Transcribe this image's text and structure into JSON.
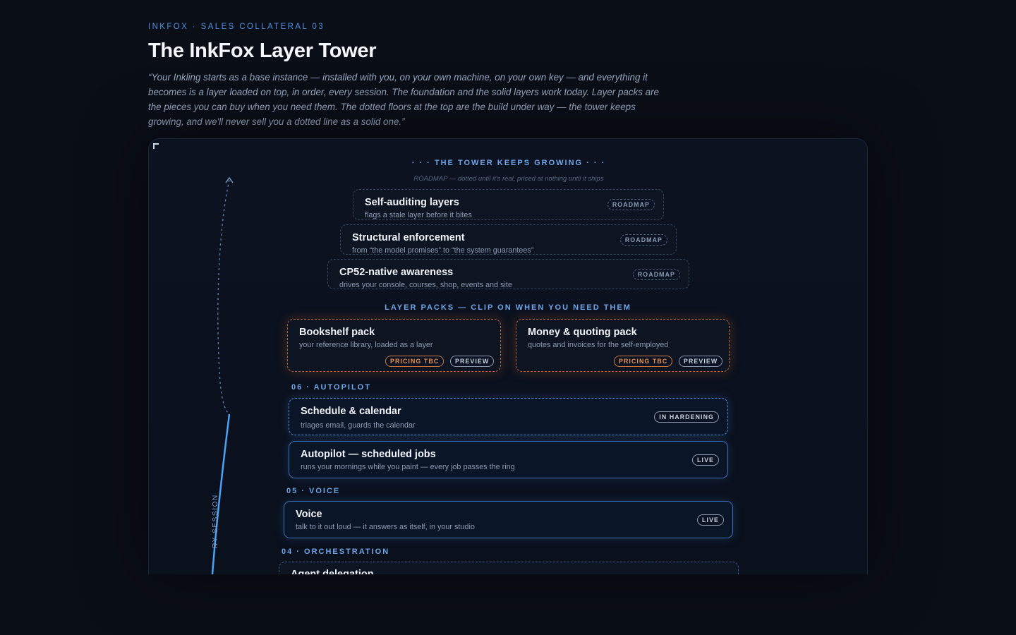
{
  "header": {
    "eyebrow": "INKFOX · SALES COLLATERAL 03",
    "title": "The InkFox Layer Tower",
    "intro": "“Your Inkling starts as a base instance — installed with you, on your own machine, on your own key — and everything it becomes is a layer loaded on top, in order, every session. The foundation and the solid layers work today. Layer packs are the pieces you can buy when you need them. The dotted floors at the top are the build under way — the tower keeps growing, and we'll never sell you a dotted line as a solid one.”"
  },
  "rail": {
    "label": "RY SESSION"
  },
  "roadmap": {
    "heading": "· · · THE TOWER KEEPS GROWING · · ·",
    "note": "ROADMAP — dotted until it's real, priced at nothing until it ships",
    "items": [
      {
        "title": "Self-auditing layers",
        "desc": "flags a stale layer before it bites",
        "badge": "ROADMAP"
      },
      {
        "title": "Structural enforcement",
        "desc": "from “the model promises” to “the system guarantees”",
        "badge": "ROADMAP"
      },
      {
        "title": "CP52-native awareness",
        "desc": "drives your console, courses, shop, events and site",
        "badge": "ROADMAP"
      }
    ]
  },
  "packs": {
    "heading": "LAYER PACKS — CLIP ON WHEN YOU NEED THEM",
    "items": [
      {
        "title": "Bookshelf pack",
        "desc": "your reference library, loaded as a layer",
        "badge_price": "PRICING TBC",
        "badge_status": "PREVIEW"
      },
      {
        "title": "Money & quoting pack",
        "desc": "quotes and invoices for the self-employed",
        "badge_price": "PRICING TBC",
        "badge_status": "PREVIEW"
      }
    ]
  },
  "floors": [
    {
      "heading": "06 · AUTOPILOT",
      "items": [
        {
          "title": "Schedule & calendar",
          "desc": "triages email, guards the calendar",
          "badge": "IN HARDENING"
        },
        {
          "title": "Autopilot — scheduled jobs",
          "desc": "runs your mornings while you paint — every job passes the ring",
          "badge": "LIVE"
        }
      ]
    },
    {
      "heading": "05 · VOICE",
      "items": [
        {
          "title": "Voice",
          "desc": "talk to it out loud — it answers as itself, in your studio",
          "badge": "LIVE"
        }
      ]
    },
    {
      "heading": "04 · ORCHESTRATION",
      "items": [
        {
          "title": "Agent delegation"
        }
      ]
    }
  ],
  "colors": {
    "background": "#0a0e17",
    "accent_blue": "#4f8fe0",
    "pack_orange": "#d0783c"
  }
}
